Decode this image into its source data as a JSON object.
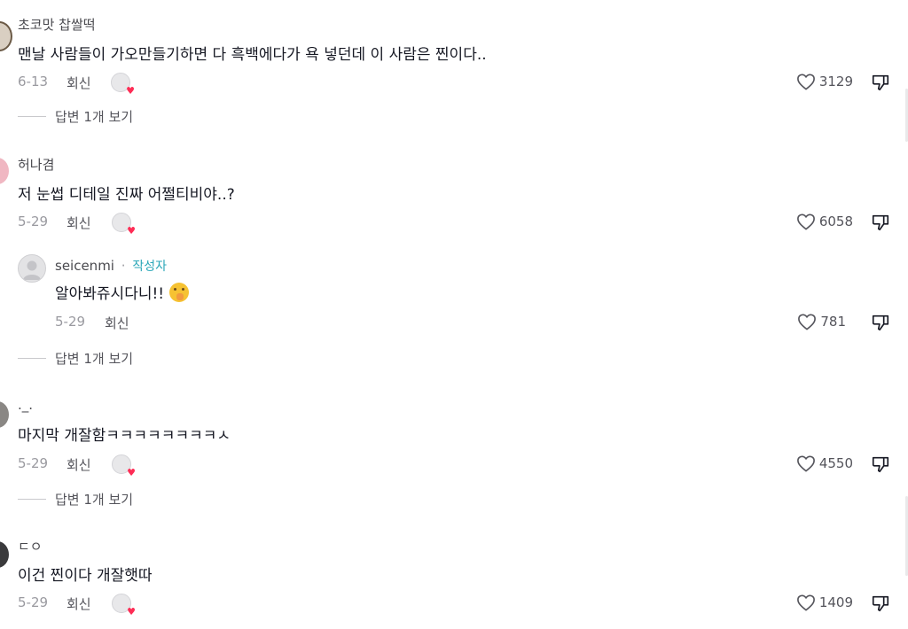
{
  "comments": [
    {
      "username": "초코맛 찹쌀떡",
      "text": "맨날 사람들이 가오만들기하면 다 흑백에다가 욕 넣던데 이 사람은 찐이다..",
      "date": "6-13",
      "reply": "회신",
      "likes": "3129",
      "view_replies": "답변 1개 보기"
    },
    {
      "username": "허나겸",
      "text": "저 눈썹 디테일 진짜 어쩔티비야..?",
      "date": "5-29",
      "reply": "회신",
      "likes": "6058",
      "author_reply": {
        "username": "seicenmi",
        "separator": "·",
        "badge": "작성자",
        "text": "알아봐쥬시다니!!",
        "date": "5-29",
        "reply": "회신",
        "likes": "781"
      },
      "view_replies": "답변 1개 보기"
    },
    {
      "username": "._.",
      "text": "마지막 개잘함ㅋㅋㅋㅋㅋㅋㅋㅋㅅ",
      "date": "5-29",
      "reply": "회신",
      "likes": "4550",
      "view_replies": "답변 1개 보기"
    },
    {
      "username": "ㄷㅇ",
      "text": "이건 찐이다 개잘햇따",
      "date": "5-29",
      "reply": "회신",
      "likes": "1409"
    }
  ],
  "colors": {
    "badge": "#2aa7b8",
    "heart": "#fe2c55"
  }
}
